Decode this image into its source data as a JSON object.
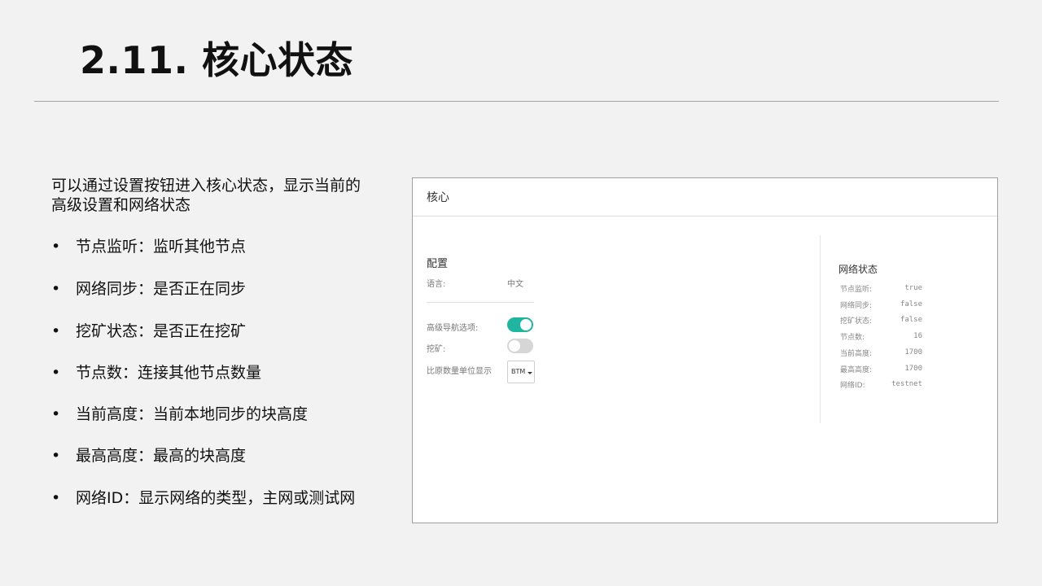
{
  "slide": {
    "title": "2.11. 核心状态",
    "intro": "可以通过设置按钮进入核心状态，显示当前的高级设置和网络状态",
    "bullet_char": "•",
    "bullets": [
      "节点监听：监听其他节点",
      "网络同步：是否正在同步",
      "挖矿状态：是否正在挖矿",
      "节点数：连接其他节点数量",
      "当前高度：当前本地同步的块高度",
      "最高高度：最高的块高度",
      "网络ID：显示网络的类型，主网或测试网"
    ]
  },
  "screenshot": {
    "header_title": "核心",
    "config": {
      "section_title": "配置",
      "language_label": "语言:",
      "language_value": "中文",
      "advanced_nav_label": "高级导航选项:",
      "advanced_nav_enabled": true,
      "mining_label": "挖矿:",
      "mining_enabled": false,
      "unit_label": "比原数量单位显示",
      "unit_value": "BTM"
    },
    "network": {
      "section_title": "网络状态",
      "rows": [
        {
          "label": "节点监听:",
          "value": "true"
        },
        {
          "label": "网络同步:",
          "value": "false"
        },
        {
          "label": "挖矿状态:",
          "value": "false"
        },
        {
          "label": "节点数:",
          "value": "16"
        },
        {
          "label": "当前高度:",
          "value": "1700"
        },
        {
          "label": "最高高度:",
          "value": "1700"
        },
        {
          "label": "网络ID:",
          "value": "testnet"
        }
      ]
    },
    "colors": {
      "toggle_on": "#1fb5a1",
      "toggle_off": "#d6d6d6"
    }
  }
}
